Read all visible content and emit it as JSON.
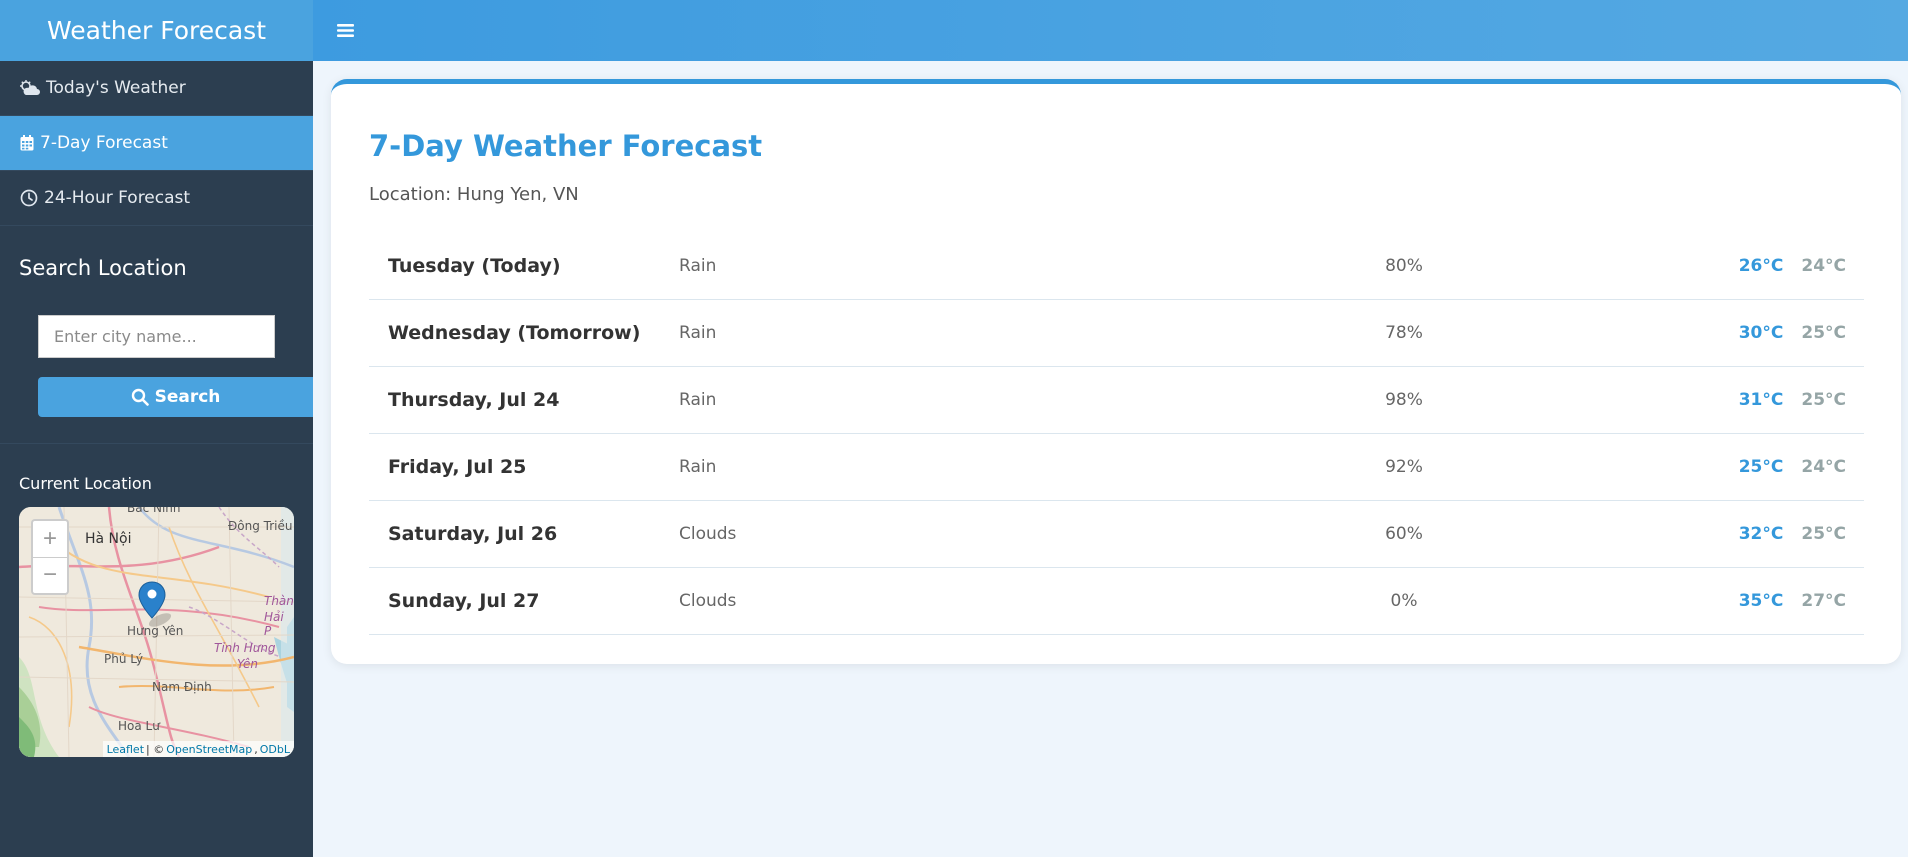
{
  "sidebar": {
    "brand": "Weather Forecast",
    "nav": [
      {
        "label": "Today's Weather",
        "icon": "cloud-sun-icon",
        "active": false
      },
      {
        "label": "7-Day Forecast",
        "icon": "calendar-icon",
        "active": true
      },
      {
        "label": "24-Hour Forecast",
        "icon": "clock-icon",
        "active": false
      }
    ],
    "search_title": "Search Location",
    "search_placeholder": "Enter city name...",
    "search_button": "Search",
    "current_location_title": "Current Location"
  },
  "map": {
    "zoom_in": "+",
    "zoom_out": "−",
    "labels": {
      "bac_ninh": "Bắc Ninh",
      "ha_noi": "Hà Nội",
      "dong_trieu": "Đông Triều",
      "hung_yen": "Hưng Yên",
      "thanh": "Thàn",
      "hai_p": "Hải P",
      "phu_ly": "Phủ Lý",
      "tinh_hung_yen_1": "Tỉnh Hưng",
      "tinh_hung_yen_2": "Yên",
      "nam_dinh": "Nam Định",
      "hoa_lu": "Hoa Lư"
    },
    "attribution": {
      "leaflet": "Leaflet",
      "separator": "| ©",
      "osm": "OpenStreetMap",
      "comma": ",",
      "odbl": "ODbL"
    }
  },
  "header": {
    "menu_icon": "hamburger-icon"
  },
  "forecast": {
    "title": "7-Day Weather Forecast",
    "location": "Location: Hung Yen, VN",
    "rows": [
      {
        "day": "Tuesday (Today)",
        "condition": "Rain",
        "pop": "80%",
        "high": "26°C",
        "low": "24°C"
      },
      {
        "day": "Wednesday (Tomorrow)",
        "condition": "Rain",
        "pop": "78%",
        "high": "30°C",
        "low": "25°C"
      },
      {
        "day": "Thursday, Jul 24",
        "condition": "Rain",
        "pop": "98%",
        "high": "31°C",
        "low": "25°C"
      },
      {
        "day": "Friday, Jul 25",
        "condition": "Rain",
        "pop": "92%",
        "high": "25°C",
        "low": "24°C"
      },
      {
        "day": "Saturday, Jul 26",
        "condition": "Clouds",
        "pop": "60%",
        "high": "32°C",
        "low": "25°C"
      },
      {
        "day": "Sunday, Jul 27",
        "condition": "Clouds",
        "pop": "0%",
        "high": "35°C",
        "low": "27°C"
      }
    ]
  },
  "colors": {
    "accent": "#3498db",
    "sidebar": "#2c3e50",
    "low_temp": "#95a5a6"
  }
}
